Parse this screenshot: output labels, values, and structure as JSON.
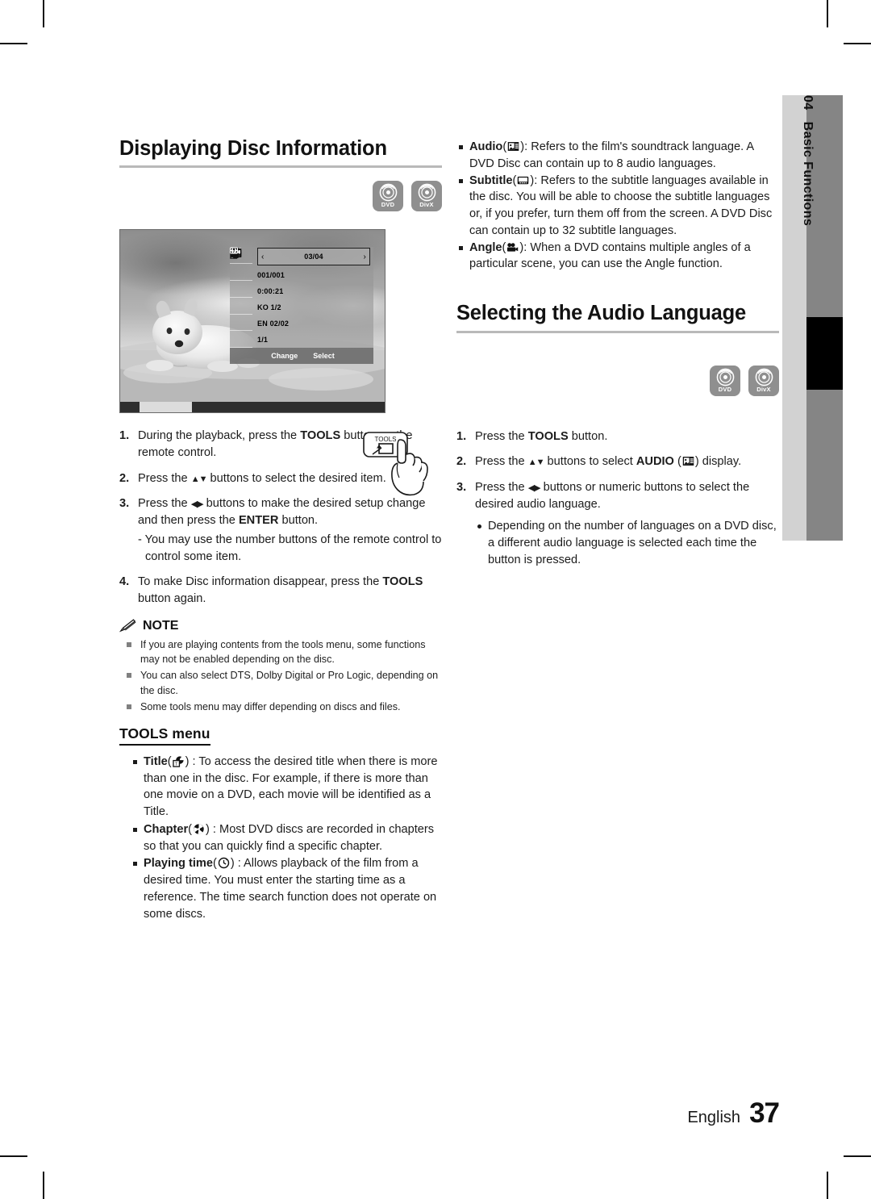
{
  "sidebar": {
    "number": "04",
    "label": "Basic Functions"
  },
  "footer": {
    "language": "English",
    "page": "37"
  },
  "left": {
    "heading": "Displaying Disc Information",
    "badges": [
      {
        "icon": "dvd-disc-icon",
        "label": "DVD"
      },
      {
        "icon": "divx-disc-icon",
        "label": "DivX"
      }
    ],
    "osd": {
      "rows": [
        {
          "icon": "title-icon",
          "value": "03/04",
          "selected": true,
          "left_arrow": "‹",
          "right_arrow": "›"
        },
        {
          "icon": "chapter-icon",
          "value": "001/001",
          "selected": false
        },
        {
          "icon": "playing-time-icon",
          "value": "0:00:21",
          "selected": false
        },
        {
          "icon": "audio-icon",
          "value": "KO 1/2",
          "selected": false
        },
        {
          "icon": "subtitle-icon",
          "value": "EN 02/02",
          "selected": false
        },
        {
          "icon": "angle-icon",
          "value": "1/1",
          "selected": false
        }
      ],
      "footer": [
        {
          "icon": "left-right-arrows-icon",
          "label": "Change"
        },
        {
          "icon": "enter-key-icon",
          "label": "Select"
        }
      ]
    },
    "steps": [
      {
        "n": "1.",
        "html": "During the playback, press the <b>TOOLS</b> button on the remote control."
      },
      {
        "n": "2.",
        "html": "Press the <span class=\"ar\">▲▼</span> buttons to select the desired item."
      },
      {
        "n": "3.",
        "html": "Press the <span class=\"ar\">◀▶</span> buttons to make the desired setup change and then press the <b>ENTER</b> button."
      },
      {
        "n": "4.",
        "html": "To make Disc information disappear, press the <b>TOOLS</b> button again."
      }
    ],
    "step3_sub": "- You may use the number buttons of the remote control to control some item.",
    "remote_button_label": "TOOLS",
    "note": {
      "title": "NOTE",
      "items": [
        "If you are playing contents from the tools menu, some functions may not be enabled depending on the disc.",
        "You can also select DTS, Dolby Digital or Pro Logic, depending on the disc.",
        "Some tools menu may differ depending on discs and files."
      ]
    },
    "tools_menu": {
      "title": "TOOLS menu",
      "items": [
        {
          "term": "Title",
          "icon": "title-icon",
          "text": " : To access the desired title when there is more than one in the disc. For example, if there is more than one movie on a DVD, each movie will be identified as a Title."
        },
        {
          "term": "Chapter",
          "icon": "chapter-icon",
          "text": " : Most DVD discs are recorded in chapters so that you can quickly find a specific chapter."
        },
        {
          "term": "Playing time",
          "icon": "playing-time-icon",
          "text": " : Allows playback of the film from a desired time. You must enter the starting time as a reference. The time search function does not operate on some discs."
        }
      ]
    }
  },
  "right": {
    "bullets": [
      {
        "term": "Audio",
        "icon": "audio-icon",
        "text": "): Refers to the film's soundtrack language. A DVD Disc can contain up to 8 audio languages."
      },
      {
        "term": "Subtitle",
        "icon": "subtitle-icon",
        "text": "): Refers to the subtitle languages available in the disc. You will be able to choose the subtitle languages or, if you prefer, turn them off from the screen. A DVD Disc can contain up to 32 subtitle languages."
      },
      {
        "term": "Angle",
        "icon": "angle-icon",
        "text": "): When a DVD contains multiple angles of a particular scene, you can use the Angle function."
      }
    ],
    "heading": "Selecting the Audio Language",
    "badges": [
      {
        "icon": "dvd-disc-icon",
        "label": "DVD"
      },
      {
        "icon": "divx-disc-icon",
        "label": "DivX"
      }
    ],
    "steps": [
      {
        "n": "1.",
        "html": "Press the <b>TOOLS</b> button."
      },
      {
        "n": "2.",
        "html": "Press the <span class=\"ar\">▲▼</span> buttons to select <b>AUDIO</b> (__AUDIO_ICON__) display."
      },
      {
        "n": "3.",
        "html": "Press the <span class=\"ar\">◀▶</span> buttons or numeric buttons to select the desired audio language."
      }
    ],
    "substep": "Depending on the number of languages on a DVD disc, a different audio language is selected each time the button is pressed."
  }
}
